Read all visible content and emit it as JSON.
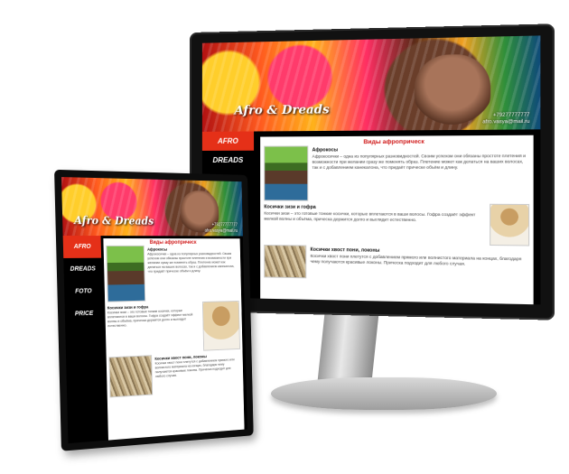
{
  "site": {
    "logo": "Afro & Dreads",
    "phone_1": "+79277777777",
    "phone_2": "afro.vasya@mail.ru",
    "nav": [
      {
        "label": "AFRO",
        "active": true
      },
      {
        "label": "DREADS",
        "active": false
      },
      {
        "label": "FOTO",
        "active": false
      },
      {
        "label": "PRICE",
        "active": false
      }
    ],
    "page_title": "Виды афроприческ",
    "sections": [
      {
        "title": "Афрокосы",
        "text": "Афрокосички – одна из популярных разновидностей. Своим успехом они обязаны простоте плетения и возможности при желании сразу же поменять образ. Плетение может как делаться на ваших волосах, так и с добавлением канекалона, что придаёт прическе объём и длину."
      },
      {
        "title": "Косички зизи и гофра",
        "text": "Косички зизи – это готовые тонкие косички, которые вплетаются в ваши волосы. Гофра создаёт эффект мелкой волны и объёма, прическа держится долго и выглядит естественно."
      },
      {
        "title": "Косички хвост пони, локоны",
        "text": "Косички хвост пони плетутся с добавлением прямого или волнистого материала на концах, благодаря чему получаются красивые локоны. Прическа подходит для любого случая."
      }
    ]
  }
}
